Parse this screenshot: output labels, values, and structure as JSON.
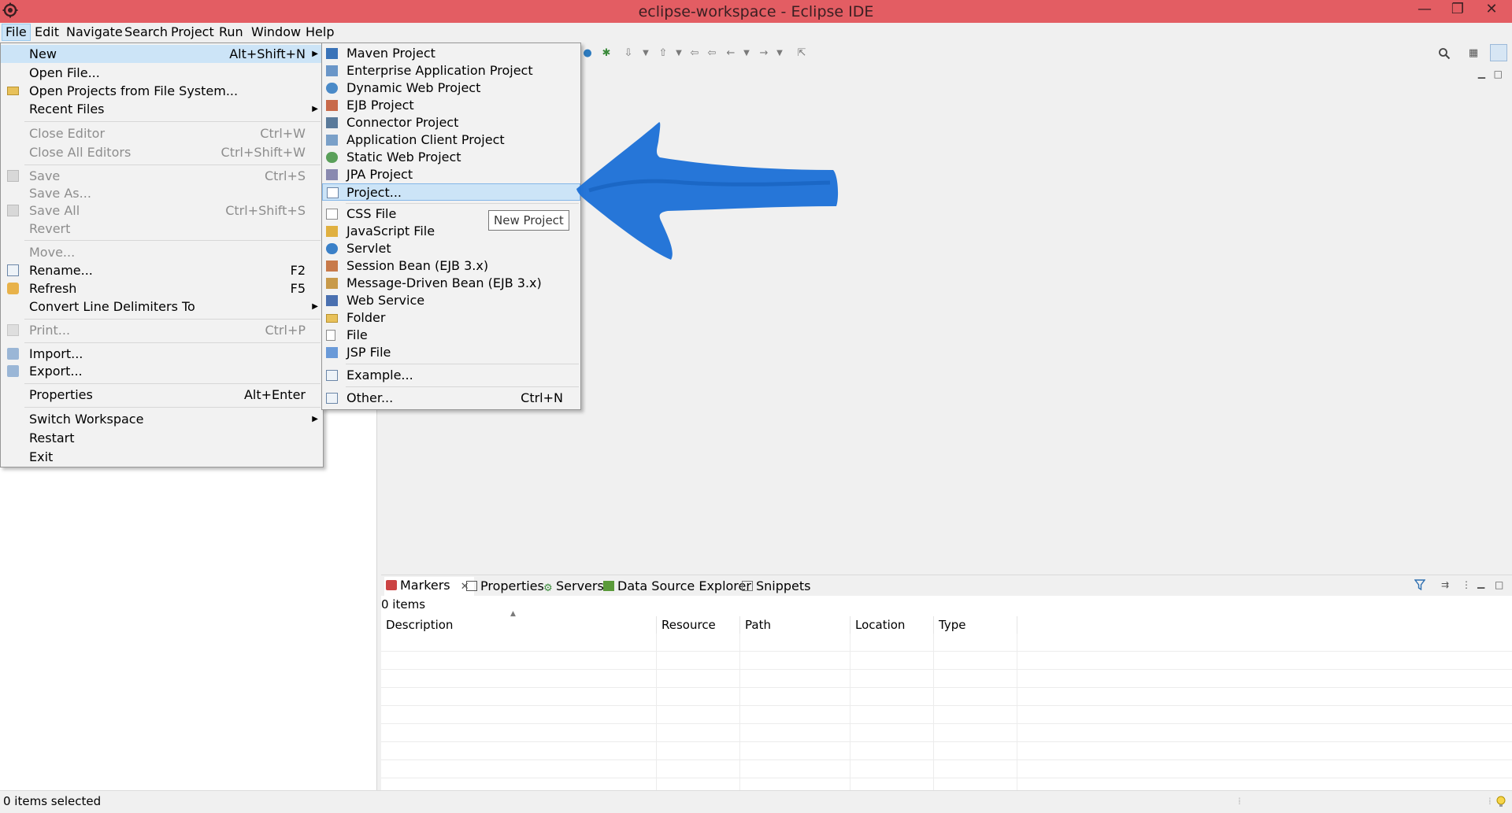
{
  "window": {
    "title": "eclipse-workspace - Eclipse IDE",
    "controls": [
      "—",
      "❐",
      "✕"
    ]
  },
  "menubar": [
    "File",
    "Edit",
    "Navigate",
    "Search",
    "Project",
    "Run",
    "Window",
    "Help"
  ],
  "file_menu": {
    "items": [
      {
        "label": "New",
        "accel": "Alt+Shift+N",
        "submenu": true
      },
      {
        "label": "Open File..."
      },
      {
        "label": "Open Projects from File System..."
      },
      {
        "label": "Recent Files",
        "submenu": true
      },
      {
        "label": "Close Editor",
        "accel": "Ctrl+W"
      },
      {
        "label": "Close All Editors",
        "accel": "Ctrl+Shift+W"
      },
      {
        "label": "Save",
        "accel": "Ctrl+S"
      },
      {
        "label": "Save As..."
      },
      {
        "label": "Save All",
        "accel": "Ctrl+Shift+S"
      },
      {
        "label": "Revert"
      },
      {
        "label": "Move..."
      },
      {
        "label": "Rename...",
        "accel": "F2"
      },
      {
        "label": "Refresh",
        "accel": "F5"
      },
      {
        "label": "Convert Line Delimiters To",
        "submenu": true
      },
      {
        "label": "Print...",
        "accel": "Ctrl+P"
      },
      {
        "label": "Import..."
      },
      {
        "label": "Export..."
      },
      {
        "label": "Properties",
        "accel": "Alt+Enter"
      },
      {
        "label": "Switch Workspace",
        "submenu": true
      },
      {
        "label": "Restart"
      },
      {
        "label": "Exit"
      }
    ]
  },
  "new_menu": {
    "items": [
      {
        "label": "Maven Project"
      },
      {
        "label": "Enterprise Application Project"
      },
      {
        "label": "Dynamic Web Project"
      },
      {
        "label": "EJB Project"
      },
      {
        "label": "Connector Project"
      },
      {
        "label": "Application Client Project"
      },
      {
        "label": "Static Web Project"
      },
      {
        "label": "JPA Project"
      },
      {
        "label": "Project..."
      },
      {
        "label": "CSS File"
      },
      {
        "label": "JavaScript File"
      },
      {
        "label": "Servlet"
      },
      {
        "label": "Session Bean (EJB 3.x)"
      },
      {
        "label": "Message-Driven Bean (EJB 3.x)"
      },
      {
        "label": "Web Service"
      },
      {
        "label": "Folder"
      },
      {
        "label": "File"
      },
      {
        "label": "JSP File"
      },
      {
        "label": "Example..."
      },
      {
        "label": "Other...",
        "accel": "Ctrl+N"
      }
    ]
  },
  "tooltip": "New Project",
  "bottom_panel": {
    "tabs": [
      "Markers",
      "Properties",
      "Servers",
      "Data Source Explorer",
      "Snippets"
    ],
    "close_glyph": "✕",
    "items_count": "0 items",
    "columns": [
      "Description",
      "Resource",
      "Path",
      "Location",
      "Type"
    ]
  },
  "status": {
    "text": "0 items selected"
  },
  "colors": {
    "titlebar": "#e35d63",
    "menu_highlight": "#cce4f7",
    "arrow": "#1a6fd6"
  },
  "icons": {
    "app": "eclipse-icon",
    "search": "search-icon",
    "perspective": "perspective-icon",
    "filter": "filter-icon",
    "lightbulb": "lightbulb-icon"
  }
}
